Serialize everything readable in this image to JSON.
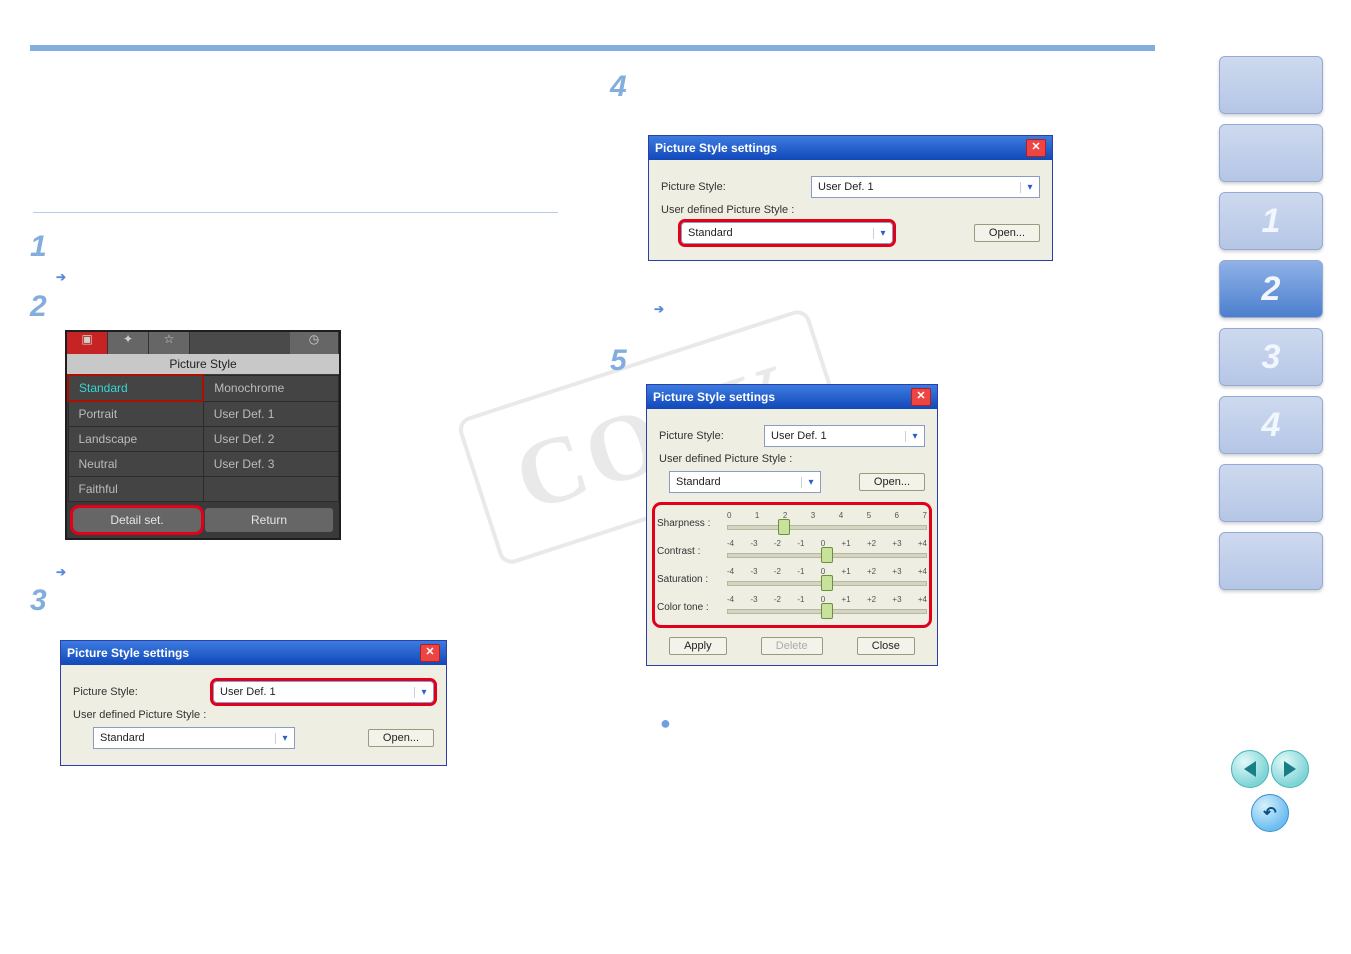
{
  "step1": {
    "num": "1",
    "arrow_target": ""
  },
  "step2": {
    "num": "2",
    "lcd": {
      "header": "Picture Style",
      "items": [
        [
          "Standard",
          "Monochrome"
        ],
        [
          "Portrait",
          "User Def. 1"
        ],
        [
          "Landscape",
          "User Def. 2"
        ],
        [
          "Neutral",
          "User Def. 3"
        ],
        [
          "Faithful",
          ""
        ]
      ],
      "detail_btn": "Detail set.",
      "return_btn": "Return"
    }
  },
  "step3": {
    "num": "3",
    "dlg": {
      "title": "Picture Style settings",
      "ps_label": "Picture Style:",
      "ps_value": "User Def. 1",
      "ud_label": "User defined Picture Style :",
      "ud_value": "Standard",
      "open_btn": "Open..."
    }
  },
  "step4": {
    "num": "4",
    "dlg": {
      "title": "Picture Style settings",
      "ps_label": "Picture Style:",
      "ps_value": "User Def. 1",
      "ud_label": "User defined Picture Style :",
      "ud_value": "Standard",
      "open_btn": "Open..."
    }
  },
  "step5": {
    "num": "5",
    "dlg": {
      "title": "Picture Style settings",
      "ps_label": "Picture Style:",
      "ps_value": "User Def. 1",
      "ud_label": "User defined Picture Style :",
      "ud_value": "Standard",
      "open_btn": "Open...",
      "sliders": {
        "sharpness": {
          "label": "Sharpness :",
          "scale": [
            "0",
            "1",
            "2",
            "3",
            "4",
            "5",
            "6",
            "7"
          ],
          "value_index": 2,
          "range": 8
        },
        "contrast": {
          "label": "Contrast :",
          "scale": [
            "-4",
            "-3",
            "-2",
            "-1",
            "0",
            "+1",
            "+2",
            "+3",
            "+4"
          ],
          "value_index": 4,
          "range": 9
        },
        "saturation": {
          "label": "Saturation :",
          "scale": [
            "-4",
            "-3",
            "-2",
            "-1",
            "0",
            "+1",
            "+2",
            "+3",
            "+4"
          ],
          "value_index": 4,
          "range": 9
        },
        "colortone": {
          "label": "Color tone :",
          "scale": [
            "-4",
            "-3",
            "-2",
            "-1",
            "0",
            "+1",
            "+2",
            "+3",
            "+4"
          ],
          "value_index": 4,
          "range": 9
        }
      },
      "apply_btn": "Apply",
      "delete_btn": "Delete",
      "close_btn": "Close"
    }
  },
  "watermark": "COPY",
  "nav": {
    "1": "1",
    "2": "2",
    "3": "3",
    "4": "4"
  }
}
